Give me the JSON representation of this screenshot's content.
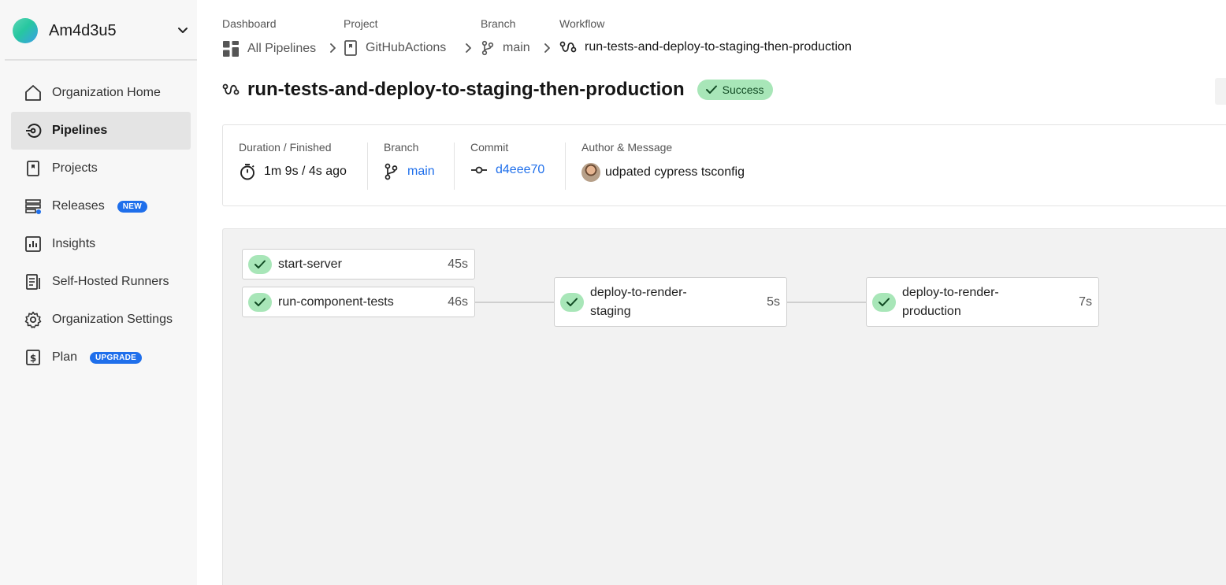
{
  "sidebar": {
    "org_name": "Am4d3u5",
    "items": [
      {
        "label": "Organization Home",
        "icon": "home-icon"
      },
      {
        "label": "Pipelines",
        "icon": "pipelines-icon",
        "active": true
      },
      {
        "label": "Projects",
        "icon": "projects-icon"
      },
      {
        "label": "Releases",
        "icon": "releases-icon",
        "badge": "NEW"
      },
      {
        "label": "Insights",
        "icon": "insights-icon"
      },
      {
        "label": "Self-Hosted Runners",
        "icon": "runners-icon"
      },
      {
        "label": "Organization Settings",
        "icon": "settings-gear-icon"
      },
      {
        "label": "Plan",
        "icon": "dollar-icon",
        "badge": "UPGRADE"
      }
    ]
  },
  "breadcrumb": {
    "dashboard": {
      "label": "Dashboard",
      "value": "All Pipelines"
    },
    "project": {
      "label": "Project",
      "value": "GitHubActions"
    },
    "branch": {
      "label": "Branch",
      "value": "main"
    },
    "workflow": {
      "label": "Workflow",
      "value": "run-tests-and-deploy-to-staging-then-production"
    }
  },
  "header": {
    "title": "run-tests-and-deploy-to-staging-then-production",
    "status": "Success"
  },
  "summary": {
    "duration": {
      "label": "Duration / Finished",
      "value": "1m 9s / 4s ago"
    },
    "branch": {
      "label": "Branch",
      "value": "main"
    },
    "commit": {
      "label": "Commit",
      "value": "d4eee70"
    },
    "author": {
      "label": "Author & Message",
      "message": "udpated cypress tsconfig"
    }
  },
  "jobs": [
    {
      "name": "start-server",
      "duration": "45s",
      "status": "success"
    },
    {
      "name": "run-component-tests",
      "duration": "46s",
      "status": "success"
    },
    {
      "name_line1": "deploy-to-render-",
      "name_line2": "staging",
      "duration": "5s",
      "status": "success"
    },
    {
      "name_line1": "deploy-to-render-",
      "name_line2": "production",
      "duration": "7s",
      "status": "success"
    }
  ],
  "colors": {
    "accent": "#1f6feb",
    "success_bg": "#a8e6b8",
    "sidebar_bg": "#f7f7f7",
    "canvas_bg": "#f2f2f2"
  }
}
